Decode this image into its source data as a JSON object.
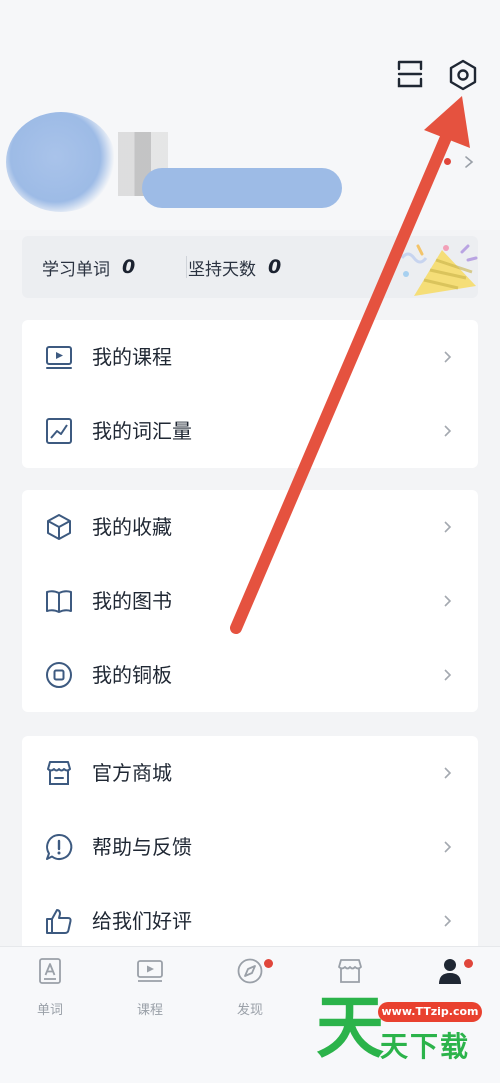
{
  "header": {
    "scan_icon": "scan-icon",
    "settings_icon": "settings-hexagon-icon"
  },
  "stats": {
    "words_label": "学习单词",
    "words_value": "0",
    "days_label": "坚持天数",
    "days_value": "0"
  },
  "menu_group_1": [
    {
      "label": "我的课程",
      "icon": "course-monitor-icon"
    },
    {
      "label": "我的词汇量",
      "icon": "vocabulary-chart-icon"
    }
  ],
  "menu_group_2": [
    {
      "label": "我的收藏",
      "icon": "favorites-cube-icon"
    },
    {
      "label": "我的图书",
      "icon": "book-icon"
    },
    {
      "label": "我的铜板",
      "icon": "coin-icon"
    }
  ],
  "menu_group_3": [
    {
      "label": "官方商城",
      "icon": "store-icon"
    },
    {
      "label": "帮助与反馈",
      "icon": "help-feedback-icon"
    },
    {
      "label": "给我们好评",
      "icon": "thumbs-up-icon"
    }
  ],
  "tabbar": {
    "tabs": [
      {
        "label": "单词",
        "icon": "word-card-icon"
      },
      {
        "label": "课程",
        "icon": "course-icon"
      },
      {
        "label": "发现",
        "icon": "compass-icon"
      },
      {
        "label": "",
        "icon": "shop-icon"
      },
      {
        "label": "",
        "icon": "profile-icon"
      }
    ]
  },
  "watermark": {
    "big": "天",
    "url": "www.TTzip.com",
    "small": "天下载"
  },
  "colors": {
    "accent_red": "#e0463b",
    "icon_blue": "#3d5a80",
    "watermark_green": "#2bb34a"
  }
}
